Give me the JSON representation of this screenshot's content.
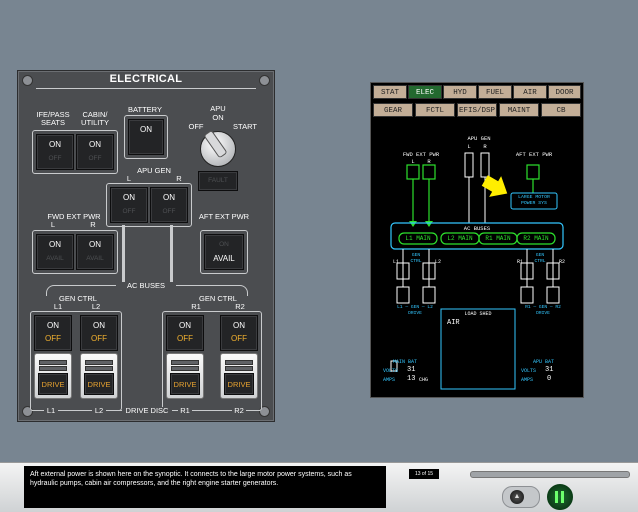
{
  "panel": {
    "title": "ELECTRICAL",
    "ife_label": "IFE/PASS\nSEATS",
    "cabin_label": "CABIN/\nUTILITY",
    "on": "ON",
    "off": "OFF",
    "battery_label": "BATTERY",
    "apu_label": "APU",
    "apu_on": "ON",
    "apu_off": "OFF",
    "apu_start": "START",
    "apu_gen_label": "APU GEN",
    "L": "L",
    "R": "R",
    "fault": "FAULT",
    "fwd_ext_pwr_label": "FWD EXT PWR",
    "aft_ext_pwr_label": "AFT EXT PWR",
    "avail": "AVAIL",
    "ac_buses": "AC BUSES",
    "gen_ctrl": "GEN CTRL",
    "L1": "L1",
    "L2": "L2",
    "R1": "R1",
    "R2": "R2",
    "drive": "DRIVE",
    "drive_disc": "DRIVE DISC"
  },
  "synoptic": {
    "tabs_row1": [
      "STAT",
      "ELEC",
      "HYD",
      "FUEL",
      "AIR",
      "DOOR"
    ],
    "tabs_row2": [
      "GEAR",
      "FCTL",
      "EFIS/DSP",
      "MAINT",
      "CB"
    ],
    "active_tab": "ELEC",
    "apu_gen": "APU GEN",
    "fwd_ext_pwr": "FWD EXT PWR",
    "aft_ext_pwr": "AFT EXT PWR",
    "large_motor": "LARGE MOTOR\nPOWER SYS",
    "ac_buses": "AC BUSES",
    "buses": [
      "L1 MAIN",
      "L2 MAIN",
      "R1 MAIN",
      "R2 MAIN"
    ],
    "gen_ctrl": "GEN\nCTRL",
    "l_drive": "L1 — GEN — L2\nDRIVE",
    "r_drive": "R1 — GEN — R2\nDRIVE",
    "load_shed": "LOAD SHED",
    "air": "AIR",
    "main_bat": "MAIN BAT",
    "apu_bat": "APU BAT",
    "volts": "VOLTS",
    "amps": "AMPS",
    "main_volts": "31",
    "main_amps": "13",
    "chg": "CHG",
    "apu_volts": "31",
    "apu_amps": "0"
  },
  "caption": "Aft external power is shown here on the synoptic. It connects to the large motor power systems, such as hydraulic pumps, cabin air compressors, and the right engine starter generators.",
  "page_indicator": "13 of 15",
  "colors": {
    "green": "#2de12d",
    "cyan": "#33c7ff",
    "amber": "#f4b22f",
    "arrow": "#ffee00"
  }
}
